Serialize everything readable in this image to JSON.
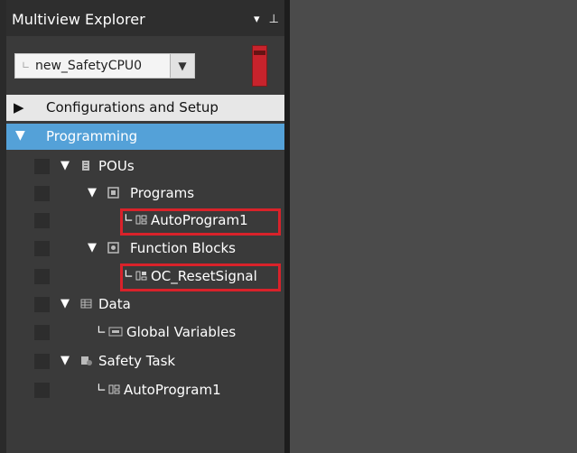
{
  "panel": {
    "title": "Multiview Explorer",
    "pin_icon": "pin-icon",
    "dropdown_icon": "dropdown-triangle-icon"
  },
  "device_selector": {
    "prefix": "∟",
    "value": "new_SafetyCPU0"
  },
  "status_indicator_color": "#c8232c",
  "sections": {
    "configurations": "Configurations and Setup",
    "programming": "Programming"
  },
  "tree": {
    "pous": "POUs",
    "programs": "Programs",
    "program_item": "AutoProgram1",
    "function_blocks": "Function Blocks",
    "fb_item": "OC_ResetSignal",
    "data": "Data",
    "global_variables": "Global Variables",
    "safety_task": "Safety Task",
    "safety_task_item": "AutoProgram1"
  },
  "highlight_color": "#d9222a"
}
